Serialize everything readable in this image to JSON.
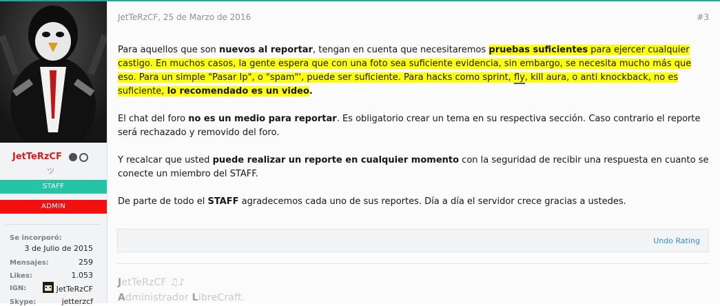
{
  "post": {
    "author": "JetTeRzCF",
    "date": "25 de Marzo de 2016",
    "number": "#3",
    "body": {
      "p1": [
        {
          "t": "Para aquellos que son ",
          "s": "plain"
        },
        {
          "t": "nuevos al reportar",
          "s": "bold"
        },
        {
          "t": ", tengan en cuenta que necesitaremos ",
          "s": "plain"
        },
        {
          "t": "pruebas suficientes",
          "s": "bold-hl"
        },
        {
          "t": " para ejercer cualquier castigo. En muchos casos, la gente espera que con una foto sea suficiente evidencia, sin embargo, se necesita mucho más que eso. Para un simple \"Pasar Ip\", o \"spam\"', puede ser suficiente. Para hacks como sprint, ",
          "s": "hl"
        },
        {
          "t": "fly",
          "s": "hl-underline"
        },
        {
          "t": ", kill aura, o anti knockback, no es suficiente, ",
          "s": "hl"
        },
        {
          "t": "lo recomendado es un video",
          "s": "bold-hl"
        },
        {
          "t": ".",
          "s": "bold"
        }
      ],
      "p2": [
        {
          "t": "El chat del foro ",
          "s": "plain"
        },
        {
          "t": "no es un medio para reportar",
          "s": "bold"
        },
        {
          "t": ". Es obligatorio crear un tema en su respectiva sección. Caso contrario el reporte será rechazado y removido del foro.",
          "s": "plain"
        }
      ],
      "p3": [
        {
          "t": "Y recalcar que usted ",
          "s": "plain"
        },
        {
          "t": "puede realizar un reporte en cualquier momento",
          "s": "bold"
        },
        {
          "t": " con la seguridad de recibir una respuesta en cuanto se conecte un miembro del STAFF.",
          "s": "plain"
        }
      ],
      "p4": [
        {
          "t": "De parte de todo el ",
          "s": "plain"
        },
        {
          "t": "STAFF",
          "s": "bold"
        },
        {
          "t": " agradecemos cada uno de sus reportes. Día a día el servidor crece gracias a ustedes.",
          "s": "plain"
        }
      ]
    },
    "undo_rating": "Undo Rating",
    "signature": {
      "line1_cap": "J",
      "line1_rest": "etTeRzCF ♫♪",
      "line2_cap1": "A",
      "line2_mid": "dministrador ",
      "line2_cap2": "L",
      "line2_rest": "ibreCraft."
    }
  },
  "sidebar": {
    "username": "JetTeRzCF",
    "user_title": "ツ",
    "banner_staff": "STAFF",
    "banner_admin": "ADMIN",
    "stats": [
      {
        "label": "Se incorporó:",
        "value": "3 de Julio de 2015"
      },
      {
        "label": "Mensajes:",
        "value": "259"
      },
      {
        "label": "Likes:",
        "value": "1.053"
      },
      {
        "label": "IGN:",
        "value": "JetTeRzCF"
      },
      {
        "label": "Skype:",
        "value": "jetterzcf"
      }
    ]
  },
  "colors": {
    "accent_teal": "#25c4a4",
    "admin_red": "#f40f0f",
    "username_red": "#e01b1b",
    "highlight_yellow": "#ffff05",
    "link_blue": "#2f8fc7"
  },
  "icons": {
    "badge1": "gear-badge-icon",
    "badge2": "check-circle-icon",
    "avatar": "penguin-avatar"
  }
}
